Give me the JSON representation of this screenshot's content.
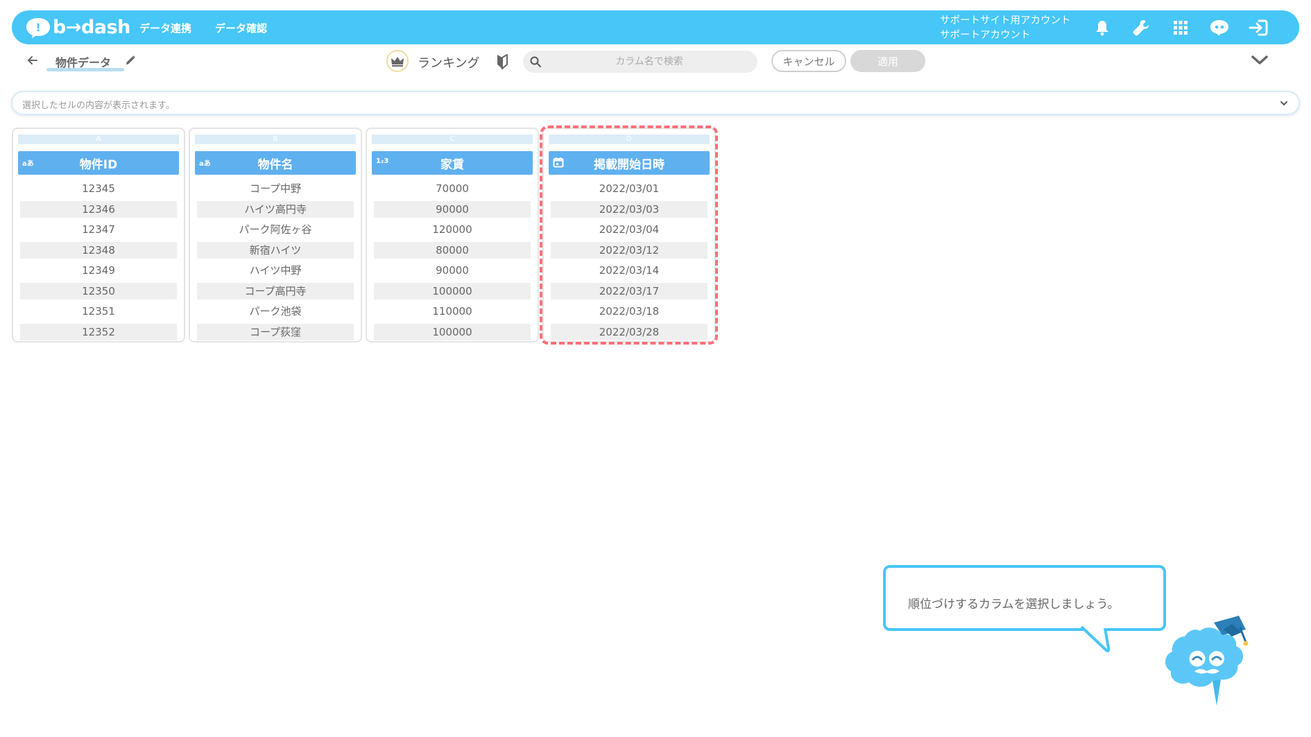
{
  "app": {
    "logo_text": "b→dash",
    "nav": [
      "データ連携",
      "データ確認"
    ],
    "account_line1": "サポートサイト用アカウント",
    "account_line2": "サポートアカウント"
  },
  "toolbar": {
    "title": "物件データ",
    "ranking_label": "ランキング",
    "search_placeholder": "カラム名で検索",
    "cancel_label": "キャンセル",
    "apply_label": "適用"
  },
  "cell_bar": {
    "placeholder": "選択したセルの内容が表示されます。"
  },
  "columns": [
    {
      "letter": "A",
      "type_icon": "aあ",
      "header": "物件ID",
      "cells": [
        "12345",
        "12346",
        "12347",
        "12348",
        "12349",
        "12350",
        "12351",
        "12352"
      ]
    },
    {
      "letter": "B",
      "type_icon": "aあ",
      "header": "物件名",
      "cells": [
        "コープ中野",
        "ハイツ高円寺",
        "パーク阿佐ヶ谷",
        "新宿ハイツ",
        "ハイツ中野",
        "コープ高円寺",
        "パーク池袋",
        "コープ荻窪"
      ]
    },
    {
      "letter": "C",
      "type_icon": "1₂3",
      "header": "家賃",
      "cells": [
        "70000",
        "90000",
        "120000",
        "80000",
        "90000",
        "100000",
        "110000",
        "100000"
      ]
    },
    {
      "letter": "D",
      "type_icon": "calendar-icon",
      "header": "掲載開始日時",
      "cells": [
        "2022/03/01",
        "2022/03/03",
        "2022/03/04",
        "2022/03/12",
        "2022/03/14",
        "2022/03/17",
        "2022/03/18",
        "2022/03/28"
      ]
    }
  ],
  "guide": {
    "message": "順位づけするカラムを選択しましょう。"
  },
  "colors": {
    "primary": "#47c6f8",
    "header": "#5fb0ef",
    "highlight": "#ff6f7a"
  }
}
